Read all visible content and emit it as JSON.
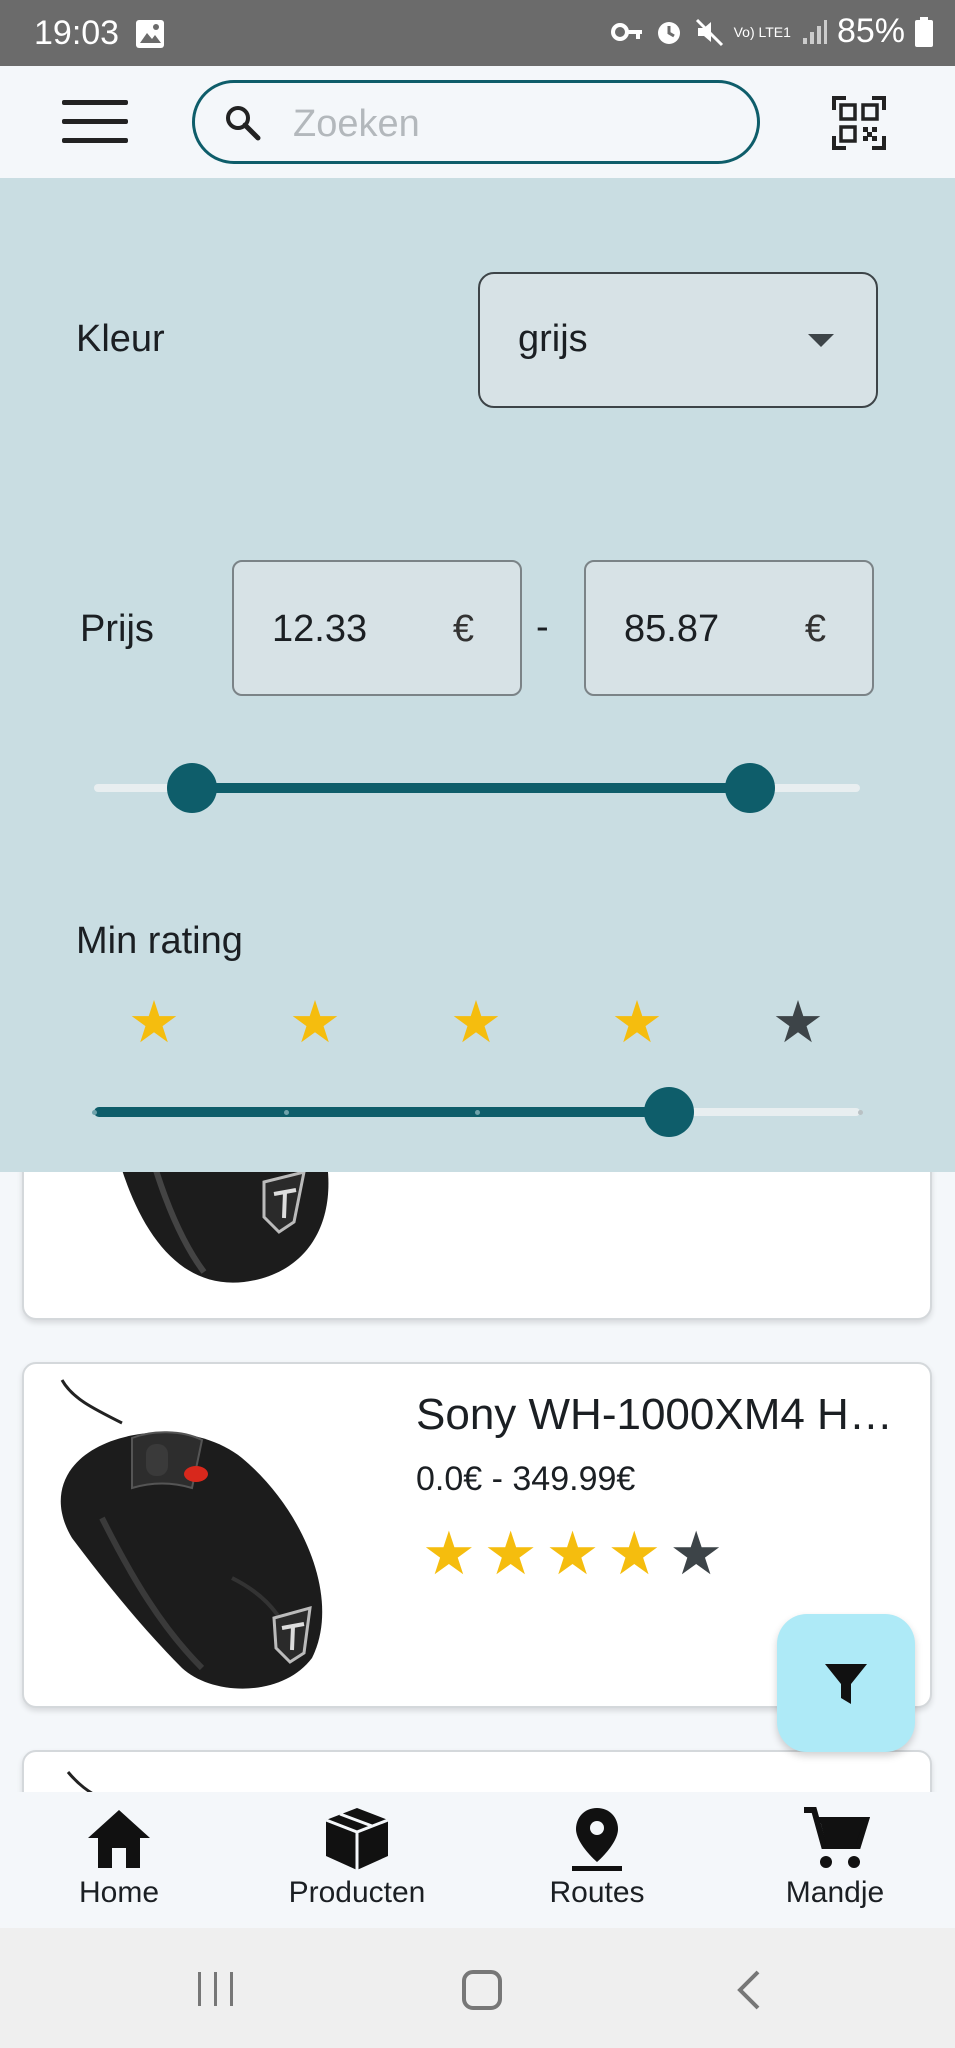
{
  "status_bar": {
    "time": "19:03",
    "battery": "85%",
    "network": "Vo) LTE1"
  },
  "search": {
    "placeholder": "Zoeken"
  },
  "filters": {
    "color_label": "Kleur",
    "color_value": "grijs",
    "price_label": "Prijs",
    "price_min": "12.33",
    "price_max": "85.87",
    "currency": "€",
    "range_separator": "-",
    "price_slider": {
      "low_fraction": 0.128,
      "high_fraction": 0.856
    },
    "rating_label": "Min rating",
    "rating_stars": [
      true,
      true,
      true,
      true,
      false
    ],
    "rating_slider": {
      "value": 3,
      "steps": 4
    }
  },
  "products": [
    {
      "name": "",
      "price": "",
      "stars": [
        true,
        true,
        true,
        true,
        false
      ]
    },
    {
      "name": "Sony WH-1000XM4 H…",
      "price": "0.0€ - 349.99€",
      "stars": [
        true,
        true,
        true,
        true,
        false
      ]
    },
    {
      "name": "",
      "price": "",
      "stars": []
    }
  ],
  "bottom_nav": [
    {
      "label": "Home",
      "icon": "home-icon"
    },
    {
      "label": "Producten",
      "icon": "package-icon"
    },
    {
      "label": "Routes",
      "icon": "location-pin-icon"
    },
    {
      "label": "Mandje",
      "icon": "cart-icon"
    }
  ],
  "colors": {
    "primary": "#0e5d6a",
    "panel": "#c9dde2",
    "star_on": "#f5bd0e",
    "star_off": "#3d4448",
    "fab": "#aeeaf7"
  }
}
